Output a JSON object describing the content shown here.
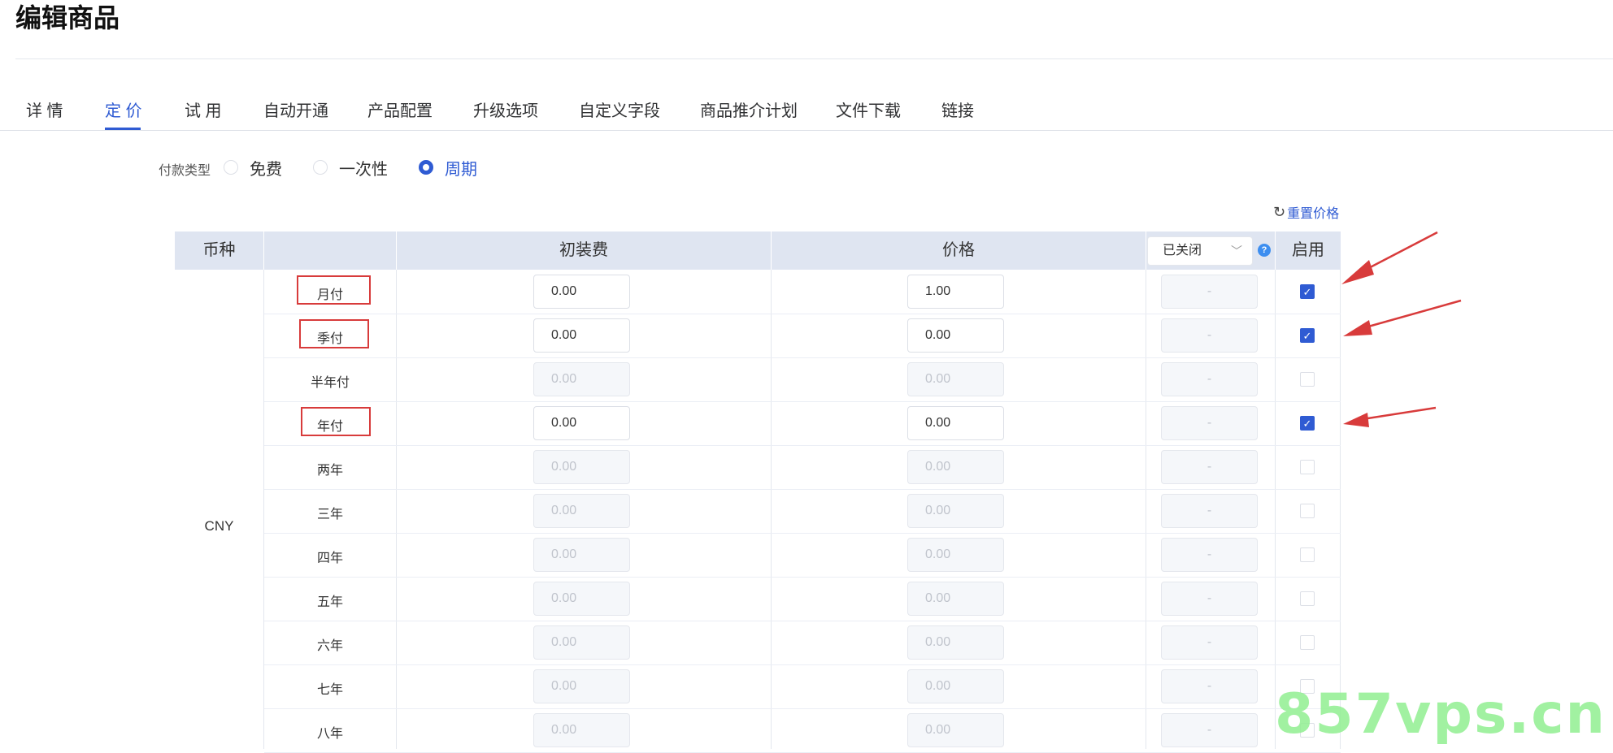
{
  "page": {
    "title": "编辑商品"
  },
  "tabs": [
    {
      "label": "详 情",
      "active": false
    },
    {
      "label": "定 价",
      "active": true
    },
    {
      "label": "试 用",
      "active": false
    },
    {
      "label": "自动开通",
      "active": false
    },
    {
      "label": "产品配置",
      "active": false
    },
    {
      "label": "升级选项",
      "active": false
    },
    {
      "label": "自定义字段",
      "active": false
    },
    {
      "label": "商品推介计划",
      "active": false
    },
    {
      "label": "文件下载",
      "active": false
    },
    {
      "label": "链接",
      "active": false
    }
  ],
  "payment": {
    "label": "付款类型",
    "options": [
      {
        "label": "免费",
        "checked": false
      },
      {
        "label": "一次性",
        "checked": false
      },
      {
        "label": "周期",
        "checked": true
      }
    ]
  },
  "reset": {
    "label": "重置价格",
    "icon": "refresh-icon"
  },
  "table": {
    "headers": {
      "currency": "币种",
      "period": "",
      "setup_fee": "初装费",
      "price": "价格",
      "select_value": "已关闭",
      "enable": "启用"
    },
    "currency": "CNY",
    "rows": [
      {
        "period": "月付",
        "setup_fee": "0.00",
        "price": "1.00",
        "extra": "-",
        "enabled": true,
        "highlighted": true
      },
      {
        "period": "季付",
        "setup_fee": "0.00",
        "price": "0.00",
        "extra": "-",
        "enabled": true,
        "highlighted": true
      },
      {
        "period": "半年付",
        "setup_fee": "0.00",
        "price": "0.00",
        "extra": "-",
        "enabled": false,
        "highlighted": false
      },
      {
        "period": "年付",
        "setup_fee": "0.00",
        "price": "0.00",
        "extra": "-",
        "enabled": true,
        "highlighted": true
      },
      {
        "period": "两年",
        "setup_fee": "0.00",
        "price": "0.00",
        "extra": "-",
        "enabled": false,
        "highlighted": false
      },
      {
        "period": "三年",
        "setup_fee": "0.00",
        "price": "0.00",
        "extra": "-",
        "enabled": false,
        "highlighted": false
      },
      {
        "period": "四年",
        "setup_fee": "0.00",
        "price": "0.00",
        "extra": "-",
        "enabled": false,
        "highlighted": false
      },
      {
        "period": "五年",
        "setup_fee": "0.00",
        "price": "0.00",
        "extra": "-",
        "enabled": false,
        "highlighted": false
      },
      {
        "period": "六年",
        "setup_fee": "0.00",
        "price": "0.00",
        "extra": "-",
        "enabled": false,
        "highlighted": false
      },
      {
        "period": "七年",
        "setup_fee": "0.00",
        "price": "0.00",
        "extra": "-",
        "enabled": false,
        "highlighted": false
      },
      {
        "period": "八年",
        "setup_fee": "0.00",
        "price": "0.00",
        "extra": "-",
        "enabled": false,
        "highlighted": false
      }
    ]
  },
  "watermark": "857vps.cn",
  "colors": {
    "accent": "#2f5bd3",
    "annotation": "#d83b3b",
    "header_bg": "#dfe5f1"
  }
}
